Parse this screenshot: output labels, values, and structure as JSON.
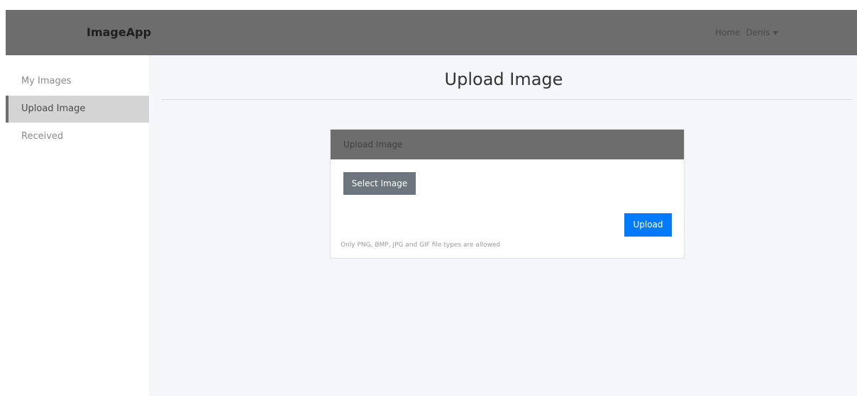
{
  "navbar": {
    "brand": "ImageApp",
    "home_label": "Home",
    "user_label": "Denis"
  },
  "sidebar": {
    "items": [
      {
        "label": "My Images",
        "active": false
      },
      {
        "label": "Upload Image",
        "active": true
      },
      {
        "label": "Received",
        "active": false
      }
    ]
  },
  "main": {
    "title": "Upload Image",
    "card": {
      "header": "Upload Image",
      "select_label": "Select Image",
      "upload_label": "Upload",
      "hint": "Only PNG, BMP, JPG and GIF file types are allowed"
    }
  },
  "colors": {
    "navbar_bg": "#6d6d6d",
    "upload_button": "#007bff",
    "select_button": "#6c757d"
  }
}
